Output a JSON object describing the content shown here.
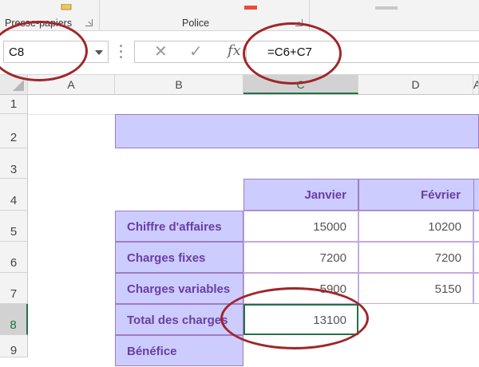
{
  "ribbon": {
    "group_clipboard": "Presse-papiers",
    "group_font": "Police",
    "col_e_partial": "A"
  },
  "namebox": {
    "value": "C8"
  },
  "formula_bar": {
    "cancel_glyph": "✕",
    "enter_glyph": "✓",
    "fx_label": "fx",
    "formula": "=C6+C7"
  },
  "columns": [
    "A",
    "B",
    "C",
    "D"
  ],
  "rows": [
    "1",
    "2",
    "3",
    "4",
    "5",
    "6",
    "7",
    "8",
    "9"
  ],
  "table": {
    "months": [
      "Janvier",
      "Février"
    ],
    "rows": [
      {
        "label": "Chiffre d'affaires",
        "values": [
          "15000",
          "10200"
        ]
      },
      {
        "label": "Charges fixes",
        "values": [
          "7200",
          "7200"
        ]
      },
      {
        "label": "Charges variables",
        "values": [
          "5900",
          "5150"
        ]
      },
      {
        "label": "Total des charges",
        "values": [
          "13100",
          ""
        ]
      },
      {
        "label": "Bénéfice",
        "values": [
          "",
          ""
        ]
      }
    ]
  },
  "colors": {
    "excel_green": "#217346",
    "header_fill": "#ccccff",
    "label_text": "#6a3ea1",
    "annotation": "#a0262a"
  }
}
